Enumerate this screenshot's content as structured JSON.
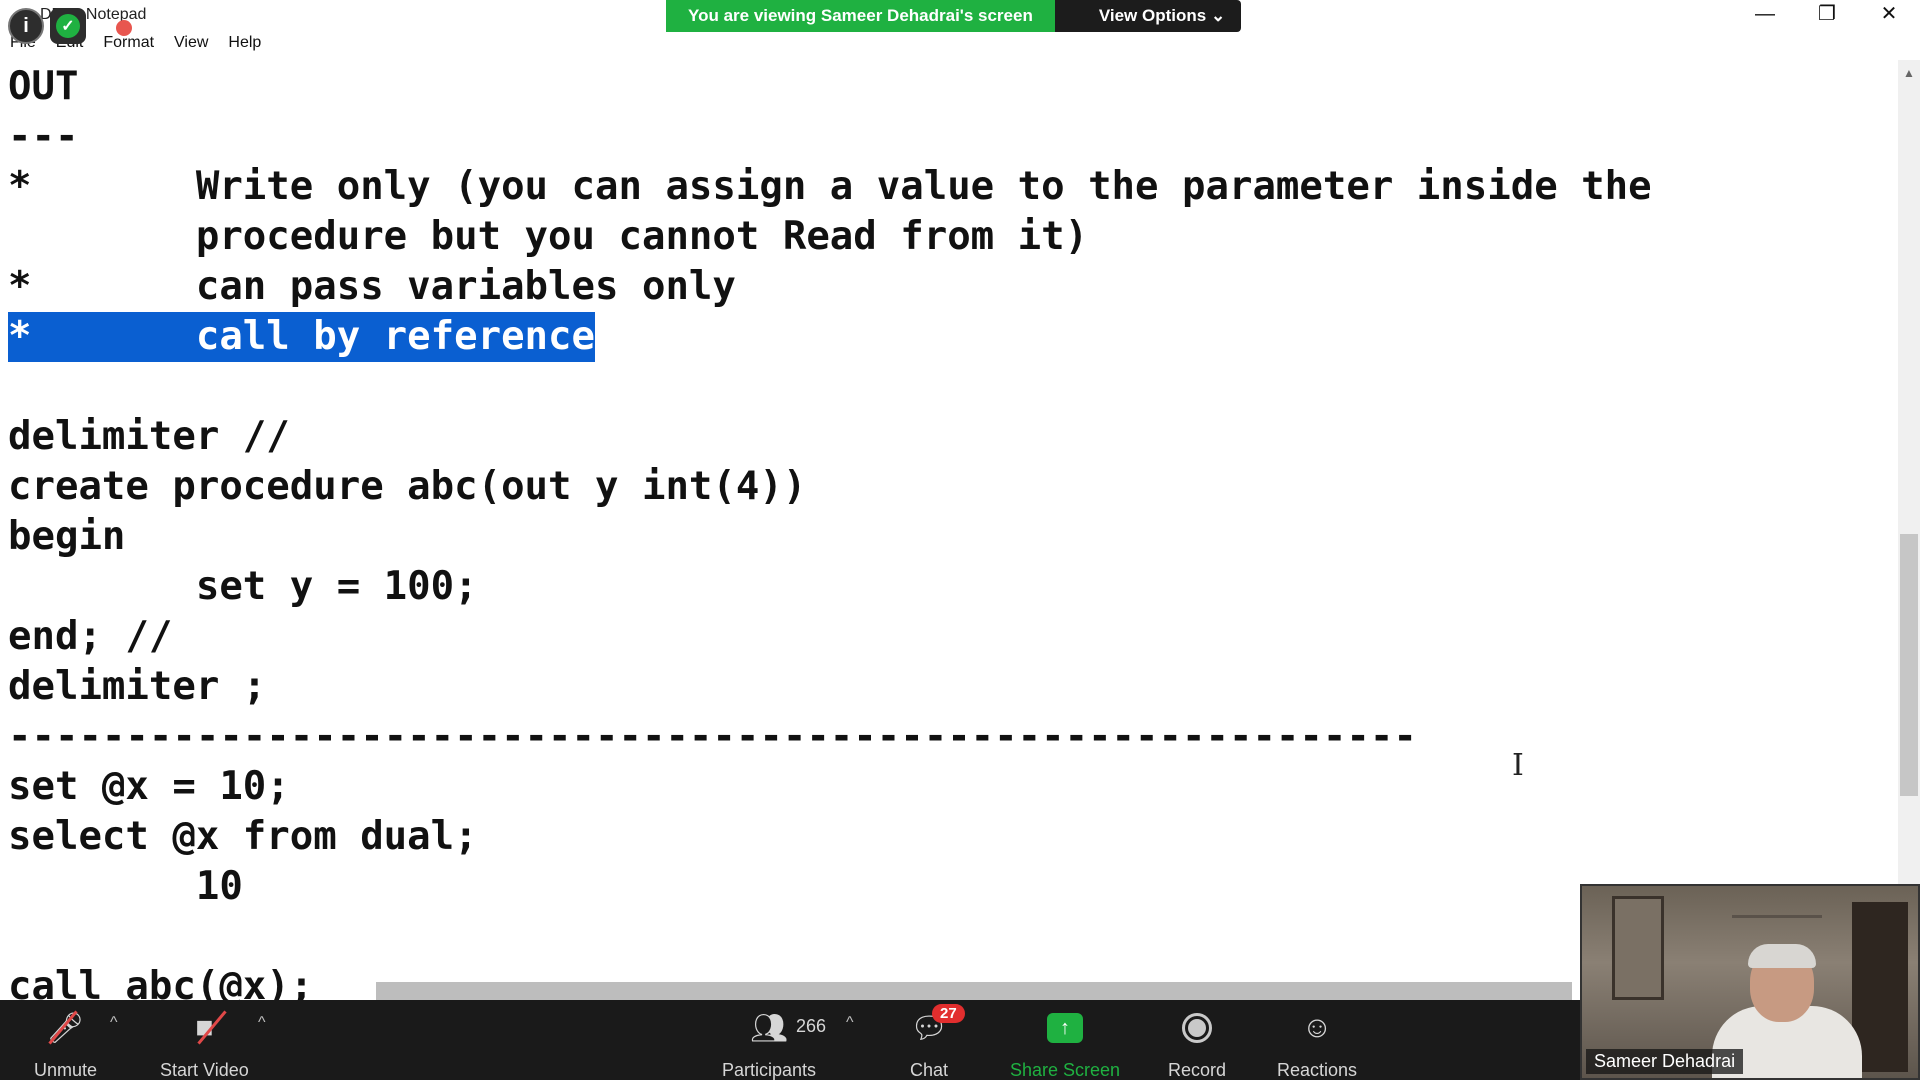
{
  "window": {
    "title": "DBT - Notepad",
    "controls": [
      "—",
      "❐",
      "✕"
    ]
  },
  "banner": {
    "message": "You are viewing Sameer Dehadrai's screen",
    "view_options": "View Options ⌄"
  },
  "menu": [
    "File",
    "Edit",
    "Format",
    "View",
    "Help"
  ],
  "editor_lines": [
    "OUT",
    "---",
    "*       Write only (you can assign a value to the parameter inside the",
    "        procedure but you cannot Read from it)",
    "*       can pass variables only",
    "*       call by reference",
    "",
    "delimiter //",
    "create procedure abc(out y int(4))",
    "begin",
    "        set y = 100;",
    "end; //",
    "delimiter ;",
    "------------------------------------------------------------",
    "set @x = 10;",
    "select @x from dual;",
    "        10",
    "",
    "call abc(@x);"
  ],
  "selected_line_index": 5,
  "zoom_toolbar": {
    "unmute": "Unmute",
    "start_video": "Start Video",
    "participants": "Participants",
    "participants_count": "266",
    "chat": "Chat",
    "chat_badge": "27",
    "share_screen": "Share Screen",
    "record": "Record",
    "reactions": "Reactions"
  },
  "video": {
    "name": "Sameer Dehadrai"
  },
  "colors": {
    "banner_green": "#1fb141",
    "selection_blue": "#0a5fd1",
    "toolbar_bg": "#1a1a1a",
    "badge_red": "#e22e2e"
  }
}
